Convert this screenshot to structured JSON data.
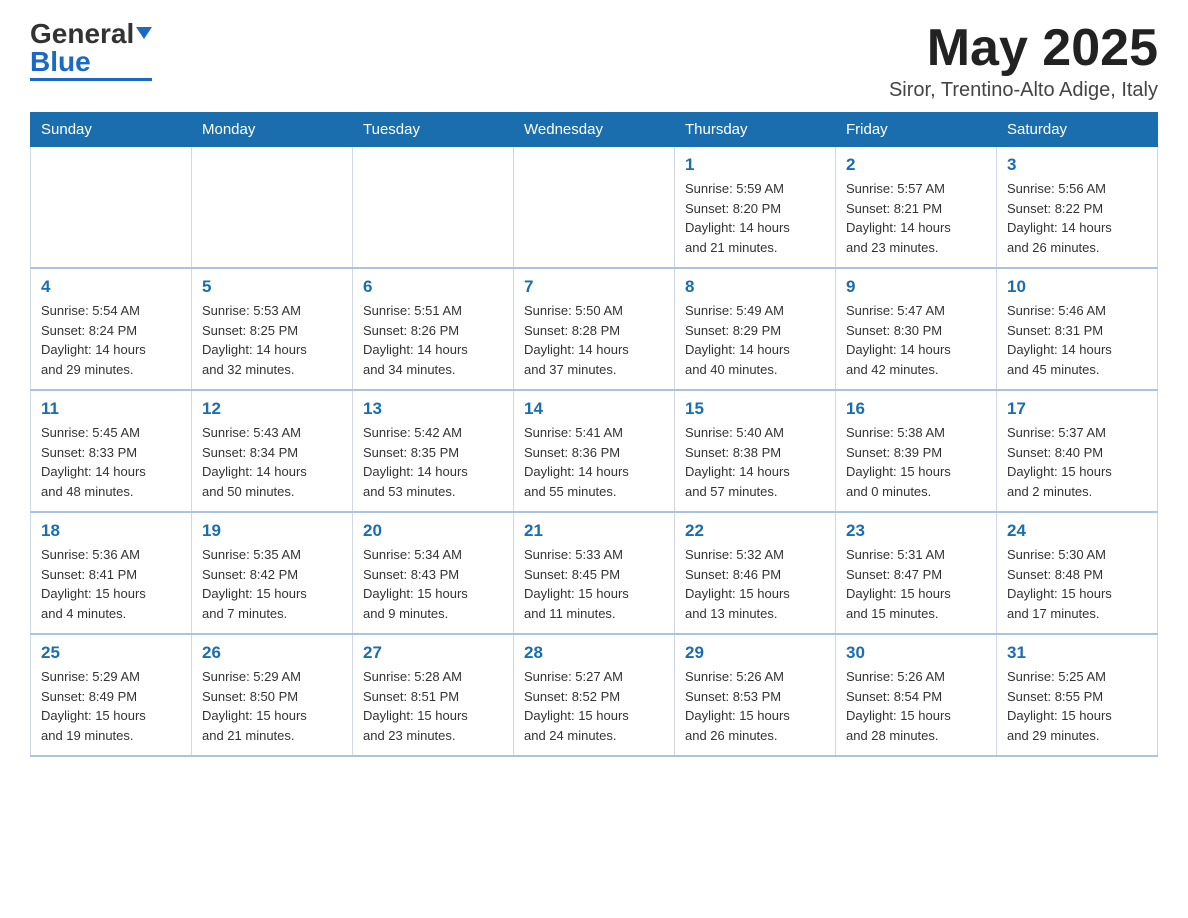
{
  "header": {
    "logo_text_black": "General",
    "logo_text_blue": "Blue",
    "month_title": "May 2025",
    "location": "Siror, Trentino-Alto Adige, Italy"
  },
  "weekdays": [
    "Sunday",
    "Monday",
    "Tuesday",
    "Wednesday",
    "Thursday",
    "Friday",
    "Saturday"
  ],
  "weeks": [
    [
      {
        "day": "",
        "info": ""
      },
      {
        "day": "",
        "info": ""
      },
      {
        "day": "",
        "info": ""
      },
      {
        "day": "",
        "info": ""
      },
      {
        "day": "1",
        "info": "Sunrise: 5:59 AM\nSunset: 8:20 PM\nDaylight: 14 hours\nand 21 minutes."
      },
      {
        "day": "2",
        "info": "Sunrise: 5:57 AM\nSunset: 8:21 PM\nDaylight: 14 hours\nand 23 minutes."
      },
      {
        "day": "3",
        "info": "Sunrise: 5:56 AM\nSunset: 8:22 PM\nDaylight: 14 hours\nand 26 minutes."
      }
    ],
    [
      {
        "day": "4",
        "info": "Sunrise: 5:54 AM\nSunset: 8:24 PM\nDaylight: 14 hours\nand 29 minutes."
      },
      {
        "day": "5",
        "info": "Sunrise: 5:53 AM\nSunset: 8:25 PM\nDaylight: 14 hours\nand 32 minutes."
      },
      {
        "day": "6",
        "info": "Sunrise: 5:51 AM\nSunset: 8:26 PM\nDaylight: 14 hours\nand 34 minutes."
      },
      {
        "day": "7",
        "info": "Sunrise: 5:50 AM\nSunset: 8:28 PM\nDaylight: 14 hours\nand 37 minutes."
      },
      {
        "day": "8",
        "info": "Sunrise: 5:49 AM\nSunset: 8:29 PM\nDaylight: 14 hours\nand 40 minutes."
      },
      {
        "day": "9",
        "info": "Sunrise: 5:47 AM\nSunset: 8:30 PM\nDaylight: 14 hours\nand 42 minutes."
      },
      {
        "day": "10",
        "info": "Sunrise: 5:46 AM\nSunset: 8:31 PM\nDaylight: 14 hours\nand 45 minutes."
      }
    ],
    [
      {
        "day": "11",
        "info": "Sunrise: 5:45 AM\nSunset: 8:33 PM\nDaylight: 14 hours\nand 48 minutes."
      },
      {
        "day": "12",
        "info": "Sunrise: 5:43 AM\nSunset: 8:34 PM\nDaylight: 14 hours\nand 50 minutes."
      },
      {
        "day": "13",
        "info": "Sunrise: 5:42 AM\nSunset: 8:35 PM\nDaylight: 14 hours\nand 53 minutes."
      },
      {
        "day": "14",
        "info": "Sunrise: 5:41 AM\nSunset: 8:36 PM\nDaylight: 14 hours\nand 55 minutes."
      },
      {
        "day": "15",
        "info": "Sunrise: 5:40 AM\nSunset: 8:38 PM\nDaylight: 14 hours\nand 57 minutes."
      },
      {
        "day": "16",
        "info": "Sunrise: 5:38 AM\nSunset: 8:39 PM\nDaylight: 15 hours\nand 0 minutes."
      },
      {
        "day": "17",
        "info": "Sunrise: 5:37 AM\nSunset: 8:40 PM\nDaylight: 15 hours\nand 2 minutes."
      }
    ],
    [
      {
        "day": "18",
        "info": "Sunrise: 5:36 AM\nSunset: 8:41 PM\nDaylight: 15 hours\nand 4 minutes."
      },
      {
        "day": "19",
        "info": "Sunrise: 5:35 AM\nSunset: 8:42 PM\nDaylight: 15 hours\nand 7 minutes."
      },
      {
        "day": "20",
        "info": "Sunrise: 5:34 AM\nSunset: 8:43 PM\nDaylight: 15 hours\nand 9 minutes."
      },
      {
        "day": "21",
        "info": "Sunrise: 5:33 AM\nSunset: 8:45 PM\nDaylight: 15 hours\nand 11 minutes."
      },
      {
        "day": "22",
        "info": "Sunrise: 5:32 AM\nSunset: 8:46 PM\nDaylight: 15 hours\nand 13 minutes."
      },
      {
        "day": "23",
        "info": "Sunrise: 5:31 AM\nSunset: 8:47 PM\nDaylight: 15 hours\nand 15 minutes."
      },
      {
        "day": "24",
        "info": "Sunrise: 5:30 AM\nSunset: 8:48 PM\nDaylight: 15 hours\nand 17 minutes."
      }
    ],
    [
      {
        "day": "25",
        "info": "Sunrise: 5:29 AM\nSunset: 8:49 PM\nDaylight: 15 hours\nand 19 minutes."
      },
      {
        "day": "26",
        "info": "Sunrise: 5:29 AM\nSunset: 8:50 PM\nDaylight: 15 hours\nand 21 minutes."
      },
      {
        "day": "27",
        "info": "Sunrise: 5:28 AM\nSunset: 8:51 PM\nDaylight: 15 hours\nand 23 minutes."
      },
      {
        "day": "28",
        "info": "Sunrise: 5:27 AM\nSunset: 8:52 PM\nDaylight: 15 hours\nand 24 minutes."
      },
      {
        "day": "29",
        "info": "Sunrise: 5:26 AM\nSunset: 8:53 PM\nDaylight: 15 hours\nand 26 minutes."
      },
      {
        "day": "30",
        "info": "Sunrise: 5:26 AM\nSunset: 8:54 PM\nDaylight: 15 hours\nand 28 minutes."
      },
      {
        "day": "31",
        "info": "Sunrise: 5:25 AM\nSunset: 8:55 PM\nDaylight: 15 hours\nand 29 minutes."
      }
    ]
  ]
}
